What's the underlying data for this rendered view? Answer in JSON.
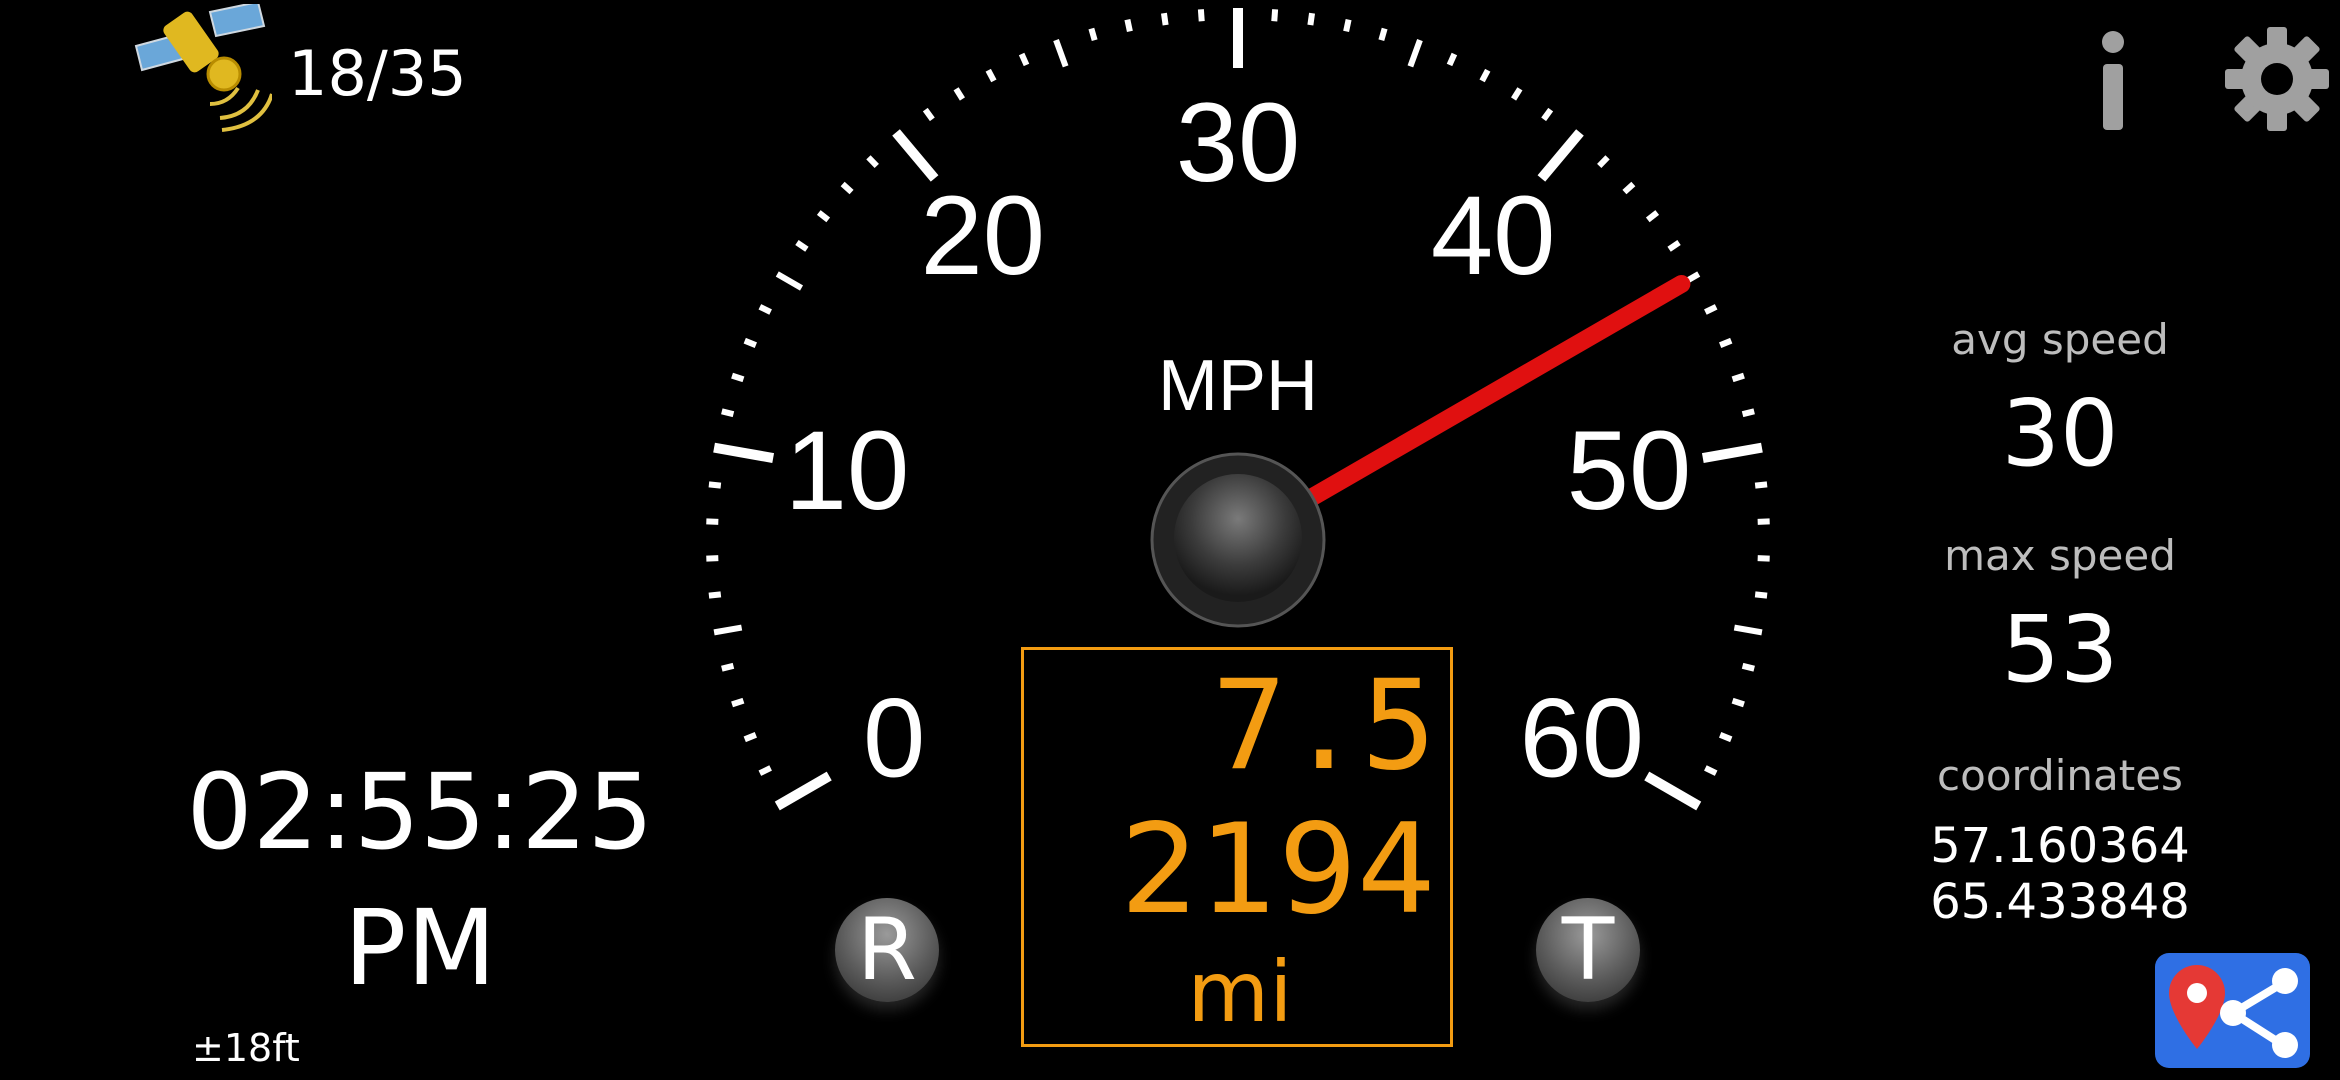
{
  "gps": {
    "satellites": "18/35",
    "accuracy": "±18ft"
  },
  "toolbar": {
    "info_icon": "info-icon",
    "settings_icon": "gear-icon"
  },
  "gauge": {
    "unit": "MPH",
    "min": 0,
    "max": 60,
    "major_labels": [
      "0",
      "10",
      "20",
      "30",
      "40",
      "50",
      "60"
    ],
    "current_speed": 45,
    "needle_color": "#e01010"
  },
  "clock": {
    "time": "02:55:25",
    "ampm": "PM"
  },
  "odometer": {
    "trip": "7.5",
    "total": "2194",
    "unit": "mi",
    "color": "#f39c12"
  },
  "buttons": {
    "reset_label": "R",
    "trip_label": "T"
  },
  "stats": {
    "avg_label": "avg speed",
    "avg_value": "30",
    "max_label": "max speed",
    "max_value": "53",
    "coords_label": "coordinates",
    "lat": "57.160364",
    "lon": "65.433848"
  },
  "share": {
    "icon": "map-share-icon",
    "color": "#2f6fe4"
  }
}
